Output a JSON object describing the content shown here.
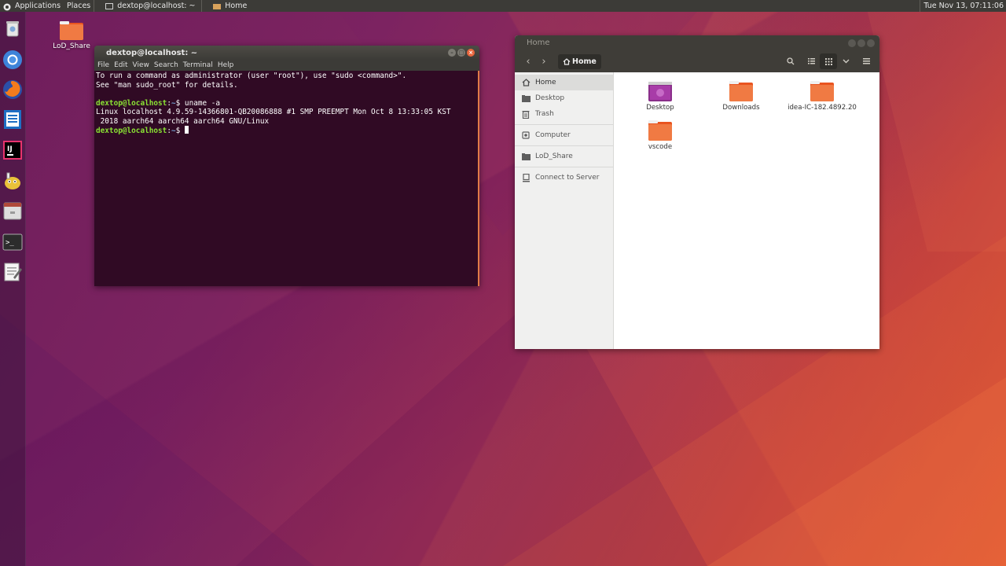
{
  "top_panel": {
    "applications": "Applications",
    "places": "Places",
    "task_terminal": "dextop@localhost: ~",
    "task_files": "Home",
    "clock": "Tue Nov 13, 07:11:06"
  },
  "launcher": [
    {
      "name": "Trash"
    },
    {
      "name": "Chromium"
    },
    {
      "name": "Firefox"
    },
    {
      "name": "LibreOffice Writer"
    },
    {
      "name": "IntelliJ IDEA"
    },
    {
      "name": "GIMP"
    },
    {
      "name": "Files"
    },
    {
      "name": "Terminal"
    },
    {
      "name": "Text Editor"
    }
  ],
  "desktop_icon": {
    "label": "LoD_Share"
  },
  "terminal": {
    "title": "dextop@localhost: ~",
    "menu": [
      "File",
      "Edit",
      "View",
      "Search",
      "Terminal",
      "Help"
    ],
    "line1": "To run a command as administrator (user \"root\"), use \"sudo <command>\".",
    "line2": "See \"man sudo_root\" for details.",
    "prompt_user": "dextop@localhost",
    "prompt_sep": ":",
    "prompt_path": "~",
    "prompt_end": "$ ",
    "command": "uname -a",
    "output1": "Linux localhost 4.9.59-14366801-QB20086888 #1 SMP PREEMPT Mon Oct 8 13:33:05 KST",
    "output2": " 2018 aarch64 aarch64 aarch64 GNU/Linux"
  },
  "files": {
    "title": "Home",
    "path_label": "Home",
    "sidebar": [
      {
        "label": "Home",
        "icon": "home-icon"
      },
      {
        "label": "Desktop",
        "icon": "folder-icon"
      },
      {
        "label": "Trash",
        "icon": "trash-icon"
      },
      {
        "label": "Computer",
        "icon": "drive-icon"
      },
      {
        "label": "LoD_Share",
        "icon": "folder-icon"
      },
      {
        "label": "Connect to Server",
        "icon": "server-icon"
      }
    ],
    "items": [
      {
        "label": "Desktop"
      },
      {
        "label": "Downloads"
      },
      {
        "label": "idea-IC-182.4892.20"
      },
      {
        "label": "vscode"
      }
    ]
  },
  "colors": {
    "terminal_bg": "#300a24",
    "prompt_user": "#8ae234",
    "prompt_path": "#729fcf",
    "folder_orange": "#e95420"
  }
}
